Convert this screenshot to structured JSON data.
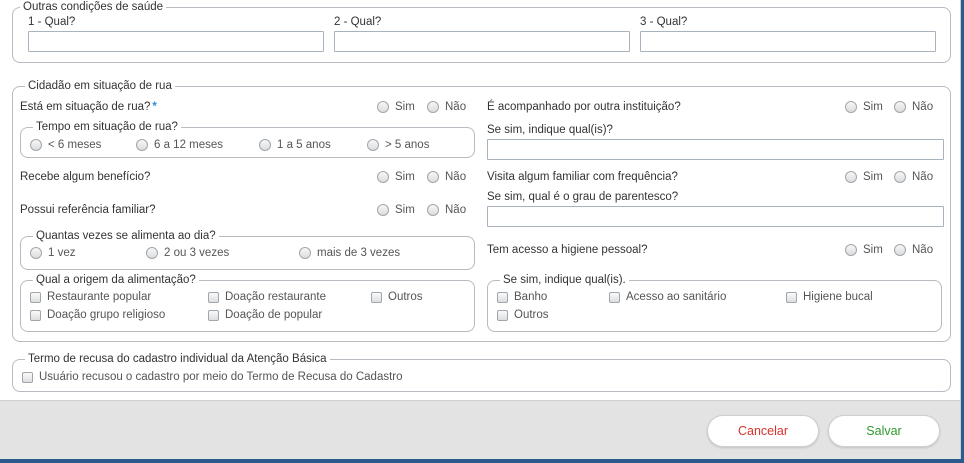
{
  "health": {
    "legend": "Outras condições de saúde",
    "fields": [
      {
        "label": "1 - Qual?",
        "value": ""
      },
      {
        "label": "2 - Qual?",
        "value": ""
      },
      {
        "label": "3 - Qual?",
        "value": ""
      }
    ]
  },
  "street": {
    "legend": "Cidadão em situação de rua",
    "is_street": {
      "label": "Está em situação de rua?",
      "required_mark": "*"
    },
    "yes": "Sim",
    "no": "Não",
    "time": {
      "legend": "Tempo em situação de rua?",
      "options": [
        "< 6 meses",
        "6 a 12 meses",
        "1 a 5 anos",
        "> 5 anos"
      ]
    },
    "benefit": {
      "label": "Recebe algum benefício?"
    },
    "family_ref": {
      "label": "Possui referência familiar?"
    },
    "meals": {
      "legend": "Quantas vezes se alimenta ao dia?",
      "options": [
        "1 vez",
        "2 ou 3 vezes",
        "mais de 3 vezes"
      ]
    },
    "food_origin": {
      "legend": "Qual a origem da alimentação?",
      "options": [
        "Restaurante popular",
        "Doação restaurante",
        "Outros",
        "Doação grupo religioso",
        "Doação de popular"
      ]
    },
    "institution": {
      "label": "É acompanhado por outra instituição?"
    },
    "institution_which": {
      "label": "Se sim, indique qual(is)?",
      "value": ""
    },
    "visits_family": {
      "label": "Visita algum familiar com frequência?"
    },
    "kinship": {
      "label": "Se sim, qual é o grau de parentesco?",
      "value": ""
    },
    "hygiene": {
      "label": "Tem acesso a higiene pessoal?"
    },
    "hygiene_which": {
      "legend": "Se sim, indique qual(is).",
      "options": [
        "Banho",
        "Acesso ao sanitário",
        "Higiene bucal",
        "Outros"
      ]
    }
  },
  "refusal": {
    "legend": "Termo de recusa do cadastro individual da Atenção Básica",
    "checkbox_label": "Usuário recusou o cadastro por meio do Termo de Recusa do Cadastro"
  },
  "actions": {
    "cancel": "Cancelar",
    "save": "Salvar",
    "cancel_color": "#d9322b",
    "save_color": "#2e9a2e"
  }
}
